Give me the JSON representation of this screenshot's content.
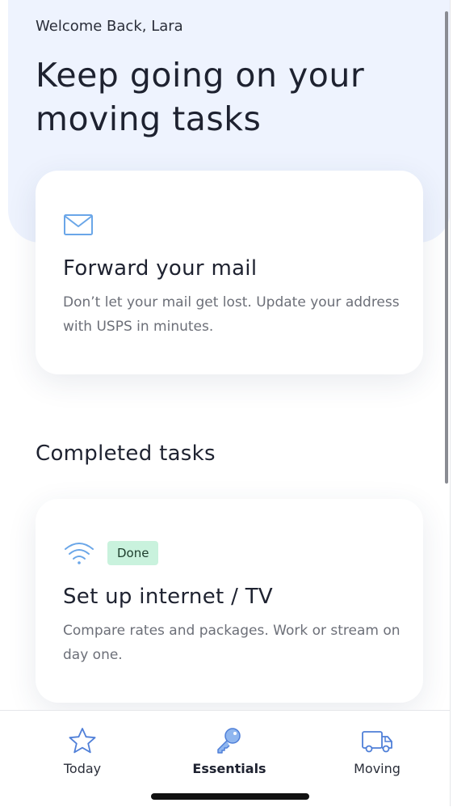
{
  "header": {
    "greeting": "Welcome Back, Lara",
    "headline": "Keep going on your moving tasks"
  },
  "active_task": {
    "icon": "mail-icon",
    "title": "Forward your mail",
    "description": "Don’t let your mail get lost. Update your address with USPS in minutes."
  },
  "completed": {
    "section_title": "Completed tasks",
    "tasks": [
      {
        "icon": "wifi-icon",
        "badge": "Done",
        "title": "Set up internet / TV",
        "description": "Compare rates and packages. Work or stream on day one."
      }
    ]
  },
  "tab_bar": {
    "tabs": [
      {
        "label": "Today",
        "icon": "star-icon"
      },
      {
        "label": "Essentials",
        "icon": "key-icon",
        "active": true
      },
      {
        "label": "Moving",
        "icon": "truck-icon"
      }
    ]
  },
  "colors": {
    "hero_background": "#eef3fe",
    "accent_blue": "#6aa6e8",
    "done_badge": "#c9f2dd"
  }
}
